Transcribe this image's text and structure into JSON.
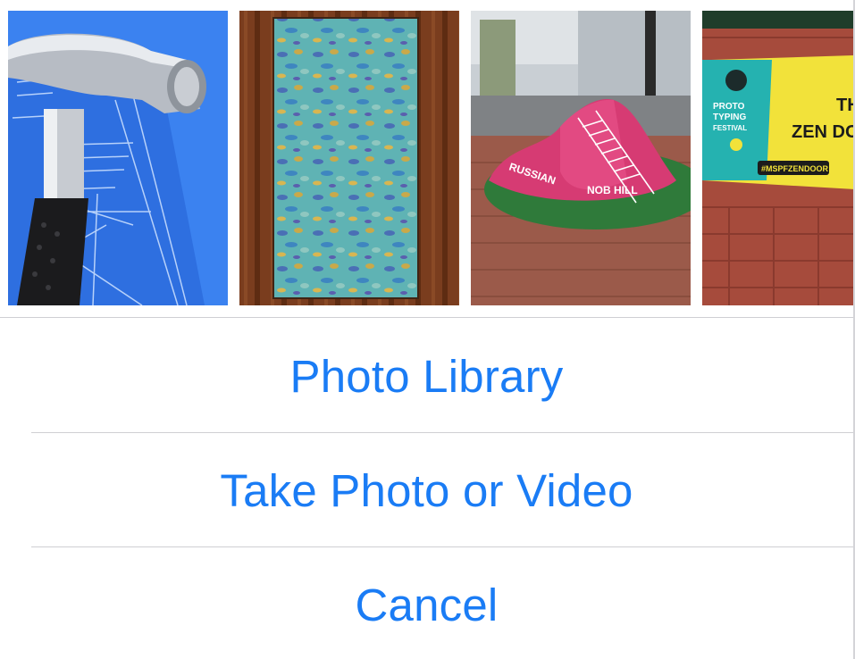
{
  "photos": [
    {
      "name": "xcode-icon-photo",
      "overlay_lines": []
    },
    {
      "name": "painted-canvas-photo",
      "overlay_lines": []
    },
    {
      "name": "street-sculpture-photo",
      "overlay_lines": [
        "RUSSIAN",
        "NOB HILL"
      ]
    },
    {
      "name": "zen-door-poster-photo",
      "overlay_lines": [
        "THE",
        "ZEN DO",
        "PROTO",
        "TYPING",
        "FESTIVAL",
        "#MSPFZENDOOR"
      ]
    }
  ],
  "actions": {
    "photo_library": "Photo Library",
    "take_photo_or_video": "Take Photo or Video",
    "cancel": "Cancel"
  },
  "colors": {
    "action_text": "#1a7cf5",
    "separator": "#cfcfd3",
    "background": "#ffffff"
  }
}
